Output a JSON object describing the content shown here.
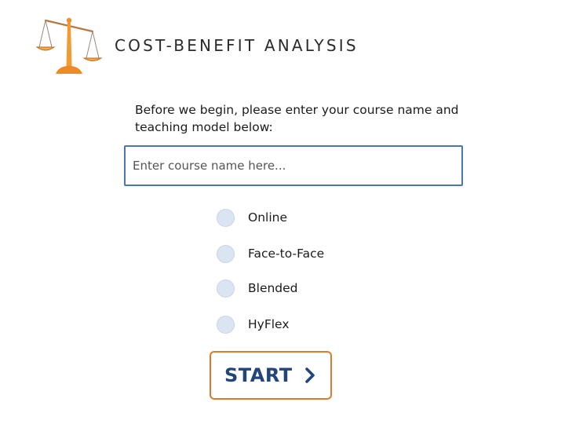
{
  "header": {
    "title": "COST-BENEFIT ANALYSIS",
    "logo_icon": "scales-of-justice-icon"
  },
  "intro": {
    "prompt": "Before we begin, please enter your course name and teaching model below:"
  },
  "course_name": {
    "value": "",
    "placeholder": "Enter course name here..."
  },
  "teaching_models": {
    "options": [
      {
        "label": "Online",
        "selected": false
      },
      {
        "label": "Face-to-Face",
        "selected": false
      },
      {
        "label": "Blended",
        "selected": false
      },
      {
        "label": "HyFlex",
        "selected": false
      }
    ]
  },
  "start_button": {
    "label": "START",
    "icon": "chevron-right-icon"
  },
  "colors": {
    "accent_orange": "#e07a2a",
    "button_text_blue": "#22467a",
    "input_border_blue": "#4a76b4",
    "radio_fill": "#dbe4f1",
    "logo_orange": "#f0a040"
  }
}
